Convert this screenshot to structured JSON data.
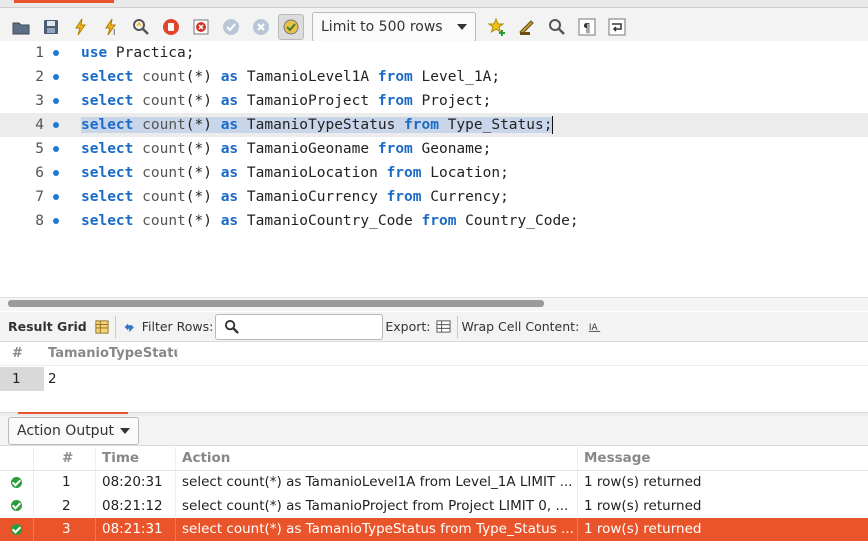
{
  "toolbar": {
    "limit_value": "Limit to 500 rows",
    "icons": [
      "open-folder-icon",
      "save-icon",
      "execute-icon",
      "execute-current-icon",
      "explain-icon",
      "stop-icon",
      "toggle-error-icon",
      "commit-icon",
      "rollback-icon",
      "autocommit-icon",
      "bookmark-icon",
      "beautify-icon",
      "find-icon",
      "invisible-chars-icon",
      "wrap-icon"
    ]
  },
  "editor": {
    "lines": [
      {
        "num": "1",
        "parts": [
          [
            "kw",
            "use"
          ],
          [
            "t",
            " Practica;"
          ]
        ]
      },
      {
        "num": "2",
        "parts": [
          [
            "kw",
            "select"
          ],
          [
            "t",
            " "
          ],
          [
            "fn",
            "count"
          ],
          [
            "t",
            "(*) "
          ],
          [
            "kw",
            "as"
          ],
          [
            "t",
            " TamanioLevel1A "
          ],
          [
            "kw",
            "from"
          ],
          [
            "t",
            " Level_1A;"
          ]
        ]
      },
      {
        "num": "3",
        "parts": [
          [
            "kw",
            "select"
          ],
          [
            "t",
            " "
          ],
          [
            "fn",
            "count"
          ],
          [
            "t",
            "(*) "
          ],
          [
            "kw",
            "as"
          ],
          [
            "t",
            " TamanioProject "
          ],
          [
            "kw",
            "from"
          ],
          [
            "t",
            " Project;"
          ]
        ]
      },
      {
        "num": "4",
        "parts": [
          [
            "kw",
            "select"
          ],
          [
            "t",
            " "
          ],
          [
            "fn",
            "count"
          ],
          [
            "t",
            "(*) "
          ],
          [
            "kw",
            "as"
          ],
          [
            "t",
            " TamanioTypeStatus "
          ],
          [
            "kw",
            "from"
          ],
          [
            "t",
            " Type_Status;"
          ]
        ]
      },
      {
        "num": "5",
        "parts": [
          [
            "kw",
            "select"
          ],
          [
            "t",
            " "
          ],
          [
            "fn",
            "count"
          ],
          [
            "t",
            "(*) "
          ],
          [
            "kw",
            "as"
          ],
          [
            "t",
            " TamanioGeoname "
          ],
          [
            "kw",
            "from"
          ],
          [
            "t",
            " Geoname;"
          ]
        ]
      },
      {
        "num": "6",
        "parts": [
          [
            "kw",
            "select"
          ],
          [
            "t",
            " "
          ],
          [
            "fn",
            "count"
          ],
          [
            "t",
            "(*) "
          ],
          [
            "kw",
            "as"
          ],
          [
            "t",
            " TamanioLocation "
          ],
          [
            "kw",
            "from"
          ],
          [
            "t",
            " Location;"
          ]
        ]
      },
      {
        "num": "7",
        "parts": [
          [
            "kw",
            "select"
          ],
          [
            "t",
            " "
          ],
          [
            "fn",
            "count"
          ],
          [
            "t",
            "(*) "
          ],
          [
            "kw",
            "as"
          ],
          [
            "t",
            " TamanioCurrency "
          ],
          [
            "kw",
            "from"
          ],
          [
            "t",
            " Currency;"
          ]
        ]
      },
      {
        "num": "8",
        "parts": [
          [
            "kw",
            "select"
          ],
          [
            "t",
            " "
          ],
          [
            "fn",
            "count"
          ],
          [
            "t",
            "(*) "
          ],
          [
            "kw",
            "as"
          ],
          [
            "t",
            " TamanioCountry_Code "
          ],
          [
            "kw",
            "from"
          ],
          [
            "t",
            " Country_Code;"
          ]
        ]
      }
    ],
    "current_line": 4
  },
  "result_bar": {
    "result_grid_label": "Result Grid",
    "filter_label": "Filter Rows:",
    "filter_value": "",
    "export_label": "Export:",
    "wrap_label": "Wrap Cell Content:"
  },
  "grid": {
    "columns": [
      "#",
      "TamanioTypeStatu"
    ],
    "rows": [
      [
        "1",
        "2"
      ]
    ]
  },
  "output": {
    "dropdown_label": "Action Output",
    "columns": [
      "",
      "#",
      "Time",
      "Action",
      "Message"
    ],
    "rows": [
      {
        "num": "1",
        "time": "08:20:31",
        "action": "select count(*) as TamanioLevel1A from Level_1A LIMIT ...",
        "message": "1 row(s) returned",
        "status": "ok"
      },
      {
        "num": "2",
        "time": "08:21:12",
        "action": "select count(*) as TamanioProject from Project LIMIT 0, ...",
        "message": "1 row(s) returned",
        "status": "ok"
      },
      {
        "num": "3",
        "time": "08:21:31",
        "action": "select count(*) as TamanioTypeStatus from Type_Status ...",
        "message": "1 row(s) returned",
        "status": "ok"
      }
    ],
    "highlight_color": "#e9542a",
    "ok_color": "#2a9d3a"
  },
  "colors": {
    "keyword": "#1a6bc8",
    "line_dot": "#1a7bd4",
    "selection": "#c9d6ea"
  }
}
